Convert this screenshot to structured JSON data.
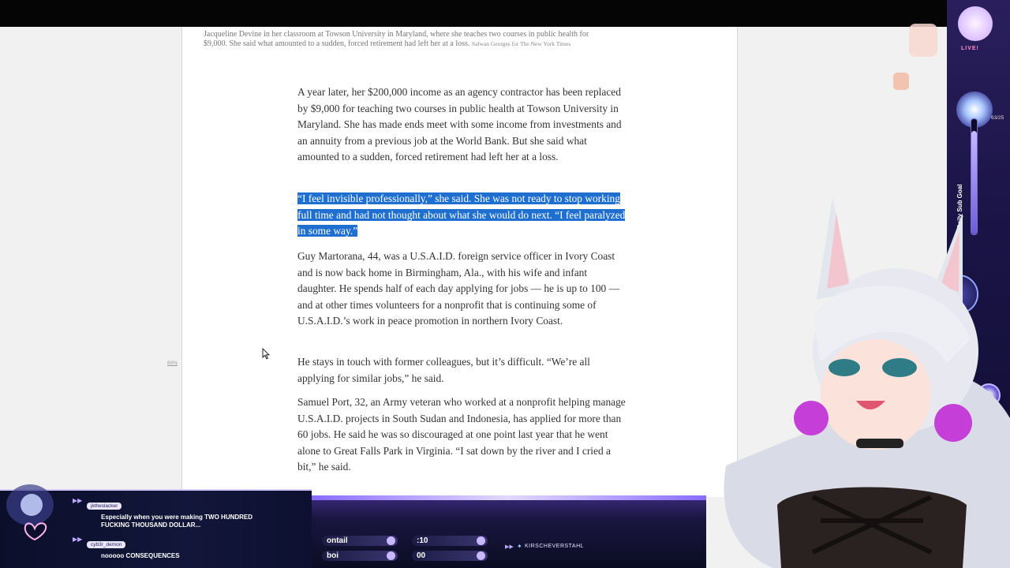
{
  "article": {
    "caption": "Jacqueline Devine in her classroom at Towson University in Maryland, where she teaches two courses in public health for $9,000. She said what amounted to a sudden, forced retirement had left her at a loss.",
    "caption_credit": "Salwan Georges for The New York Times",
    "paragraphs": [
      "A year later, her $200,000 income as an agency contractor has been replaced by $9,000 for teaching two courses in public health at Towson University in Maryland. She has made ends meet with some income from investments and an annuity from a previous job at the World Bank. But she said what amounted to a sudden, forced retirement had left her at a loss.",
      "“I feel invisible professionally,” she said. She was not ready to stop working full time and had not thought about what she would do next. “I feel paralyzed in some way.”",
      "Guy Martorana, 44, was a U.S.A.I.D. foreign service officer in Ivory Coast and is now back home in Birmingham, Ala., with his wife and infant daughter. He spends half of each day applying for jobs — he is up to 100 —  and at other times volunteers for a nonprofit that is continuing some of U.S.A.I.D.’s work in peace promotion in northern Ivory Coast.",
      "He stays in touch with former colleagues, but it’s difficult. “We’re all applying for similar jobs,” he said.",
      "Samuel Port, 32, an Army veteran who worked at a nonprofit helping manage U.S.A.I.D. projects in South Sudan and Indonesia, has applied for more than 60 jobs. He said he was so discouraged at one point last year that he went alone to Great Falls Park in Virginia. “I sat down by the river and I cried a bit,” he said."
    ],
    "zoom_label": "60%"
  },
  "chat": {
    "messages": [
      {
        "user": "jktheslacker",
        "text": "Especially when you were making TWO HUNDRED FUCKING THOUSAND DOLLAR..."
      },
      {
        "user": "cyb3r_demon",
        "text": "nooooo CONSEQUENCES"
      }
    ]
  },
  "status_bar": {
    "pill1": "ontail",
    "pill2": "boi",
    "pill3": ":10",
    "pill4": "00",
    "twitter": "KIRSCHEVERSTAHL"
  },
  "overlay": {
    "live": "LIVE!",
    "sub_goal_label": "Daily Sub Goal",
    "goal_count": "63/25",
    "sub_goal_progress": 0.9
  },
  "colors": {
    "highlight": "#1e6fd0",
    "overlay_purple": "#2a1f5c",
    "chat_bg": "#0b0f2a"
  }
}
